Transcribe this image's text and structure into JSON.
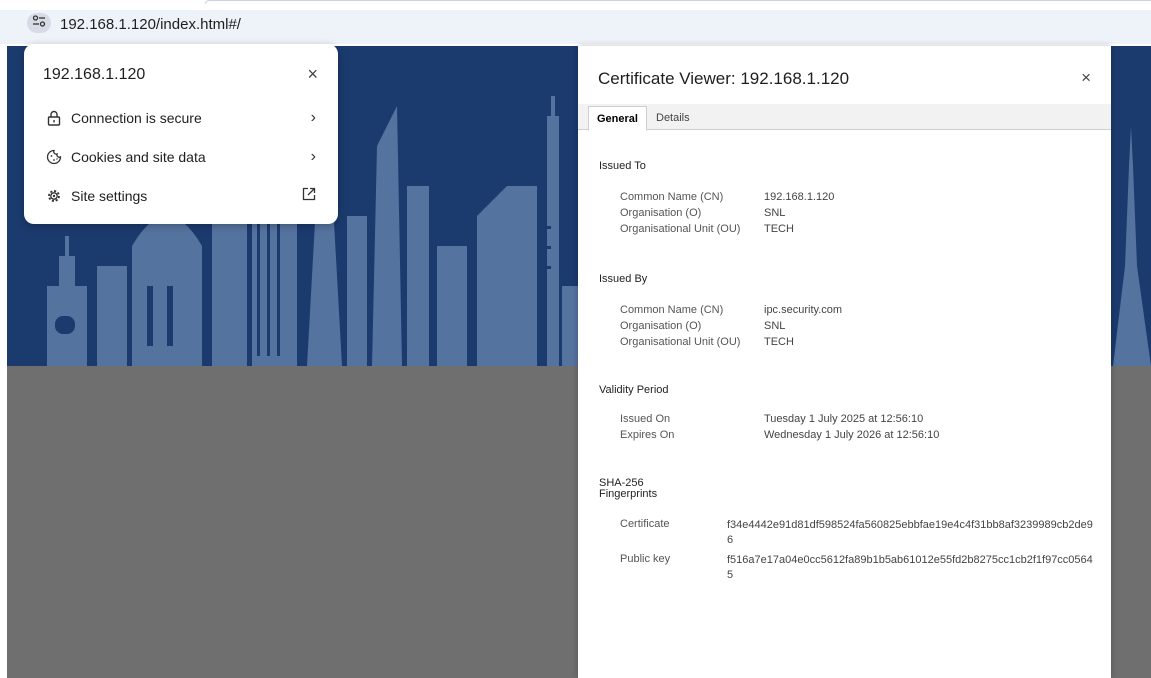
{
  "browser": {
    "url": "192.168.1.120/index.html#/",
    "site_info_icon": "tune-icon"
  },
  "popup": {
    "title": "192.168.1.120",
    "close": "×",
    "rows": [
      {
        "label": "Connection is secure",
        "icon": "lock-icon",
        "trail": "›"
      },
      {
        "label": "Cookies and site data",
        "icon": "cookie-icon",
        "trail": "›"
      },
      {
        "label": "Site settings",
        "icon": "gear-icon",
        "trail": "open-in-new-icon"
      }
    ]
  },
  "cert": {
    "title": "Certificate Viewer: 192.168.1.120",
    "close": "×",
    "tabs": [
      "General",
      "Details"
    ],
    "issued_to": {
      "heading": "Issued To",
      "rows": [
        {
          "k": "Common Name (CN)",
          "v": "192.168.1.120"
        },
        {
          "k": "Organisation (O)",
          "v": "SNL"
        },
        {
          "k": "Organisational Unit (OU)",
          "v": "TECH"
        }
      ]
    },
    "issued_by": {
      "heading": "Issued By",
      "rows": [
        {
          "k": "Common Name (CN)",
          "v": "ipc.security.com"
        },
        {
          "k": "Organisation (O)",
          "v": "SNL"
        },
        {
          "k": "Organisational Unit (OU)",
          "v": "TECH"
        }
      ]
    },
    "validity": {
      "heading": "Validity Period",
      "rows": [
        {
          "k": "Issued On",
          "v": "Tuesday 1 July 2025 at 12:56:10"
        },
        {
          "k": "Expires On",
          "v": "Wednesday 1 July 2026 at 12:56:10"
        }
      ]
    },
    "fingerprints": {
      "heading_line1": "SHA-256",
      "heading_line2": "Fingerprints",
      "rows": [
        {
          "k": "Certificate",
          "v": "f34e4442e91d81df598524fa560825ebbfae19e4c4f31bb8af3239989cb2de96"
        },
        {
          "k": "Public key",
          "v": "f516a7e17a04e0cc5612fa89b1b5ab61012e55fd2b8275cc1cb2f1f97cc05645"
        }
      ]
    }
  },
  "colors": {
    "hero": "#1b3a6d",
    "skyline": "#55739f",
    "page_bg": "#6f6f6f",
    "omnibox": "#eef2f9"
  }
}
